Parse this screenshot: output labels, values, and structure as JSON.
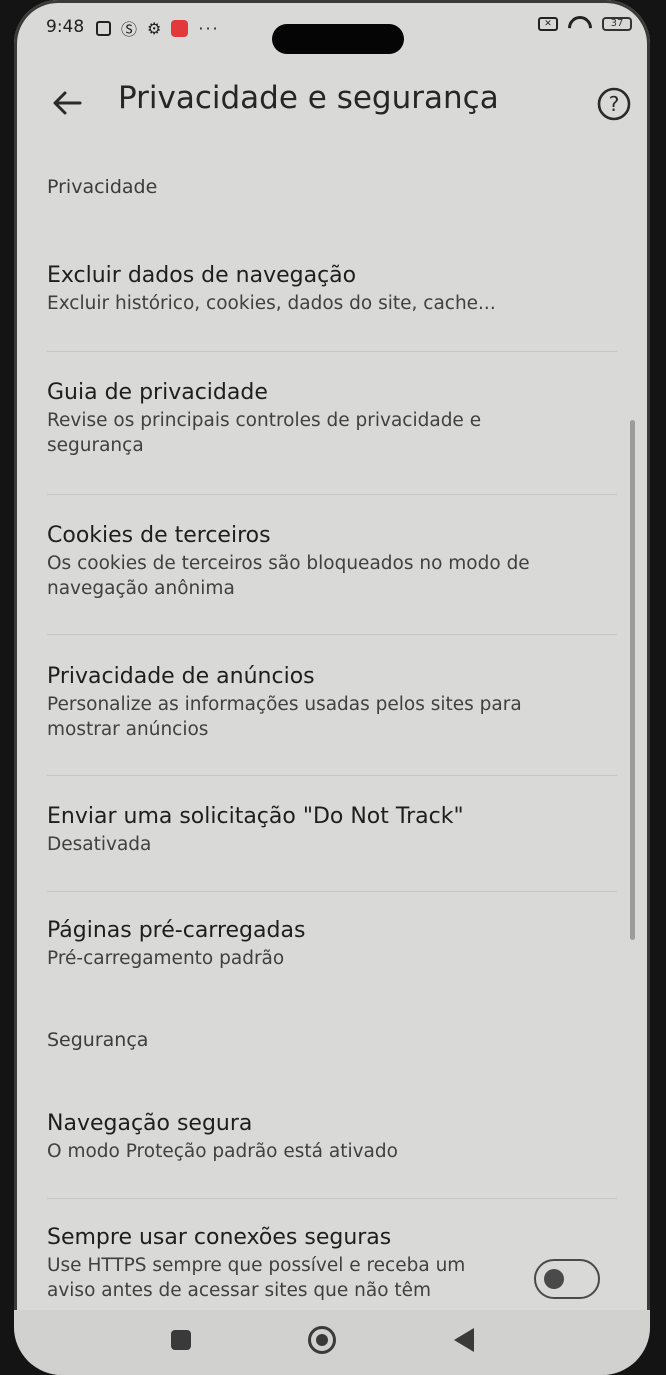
{
  "status_bar": {
    "time": "9:48",
    "battery": "37"
  },
  "toolbar": {
    "title": "Privacidade e segurança"
  },
  "sections": {
    "privacy": {
      "header": "Privacidade",
      "items": [
        {
          "title": "Excluir dados de navegação",
          "subtitle": "Excluir histórico, cookies, dados do site, cache..."
        },
        {
          "title": "Guia de privacidade",
          "subtitle": "Revise os principais controles de privacidade e segurança"
        },
        {
          "title": "Cookies de terceiros",
          "subtitle": "Os cookies de terceiros são bloqueados no modo de navegação anônima"
        },
        {
          "title": "Privacidade de anúncios",
          "subtitle": "Personalize as informações usadas pelos sites para mostrar anúncios"
        },
        {
          "title": "Enviar uma solicitação \"Do Not Track\"",
          "subtitle": "Desativada"
        },
        {
          "title": "Páginas pré-carregadas",
          "subtitle": "Pré-carregamento padrão"
        }
      ]
    },
    "security": {
      "header": "Segurança",
      "items": [
        {
          "title": "Navegação segura",
          "subtitle": "O modo Proteção padrão está ativado"
        },
        {
          "title": "Sempre usar conexões seguras",
          "subtitle": "Use HTTPS sempre que possível e receba um aviso antes de acessar sites que não têm",
          "toggle_on": false
        }
      ]
    }
  },
  "icons": {
    "back": "arrow-left-icon",
    "help": "help-circle-icon",
    "nav_recent": "square-icon",
    "nav_home": "circle-icon",
    "nav_back": "triangle-left-icon"
  }
}
